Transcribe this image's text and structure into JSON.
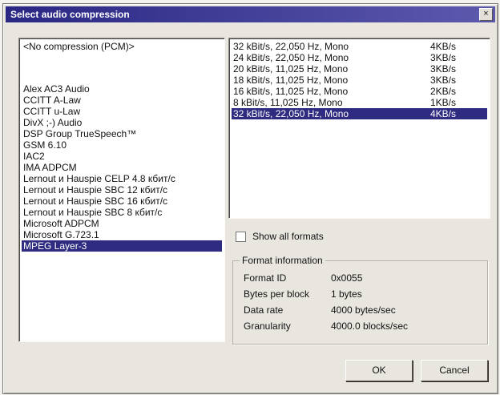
{
  "window": {
    "title": "Select audio compression",
    "close_glyph": "×"
  },
  "codecs": {
    "items": [
      "<No compression (PCM)>",
      "",
      "",
      "",
      "Alex AC3 Audio",
      "CCITT A-Law",
      "CCITT u-Law",
      "DivX ;-) Audio",
      "DSP Group TrueSpeech™",
      "GSM 6.10",
      "IAC2",
      "IMA ADPCM",
      "Lernout и Hauspie CELP 4.8 кбит/с",
      "Lernout и Hauspie SBC 12 кбит/с",
      "Lernout и Hauspie SBC 16 кбит/с",
      "Lernout и Hauspie SBC 8 кбит/с",
      "Microsoft ADPCM",
      "Microsoft G.723.1",
      "MPEG Layer-3"
    ],
    "selected": "MPEG Layer-3"
  },
  "formats": {
    "items": [
      {
        "name": "32 kBit/s, 22,050 Hz, Mono",
        "size": "4KB/s"
      },
      {
        "name": "24 kBit/s, 22,050 Hz, Mono",
        "size": "3KB/s"
      },
      {
        "name": "20 kBit/s, 11,025 Hz, Mono",
        "size": "3KB/s"
      },
      {
        "name": "18 kBit/s, 11,025 Hz, Mono",
        "size": "3KB/s"
      },
      {
        "name": "16 kBit/s, 11,025 Hz, Mono",
        "size": "2KB/s"
      },
      {
        "name": "8 kBit/s, 11,025 Hz, Mono",
        "size": "1KB/s"
      },
      {
        "name": "32 kBit/s, 22,050 Hz, Mono",
        "size": "4KB/s"
      }
    ],
    "selected_index": 6
  },
  "show_all_formats": {
    "label": "Show all formats",
    "checked": false
  },
  "format_info": {
    "legend": "Format information",
    "rows": [
      {
        "label": "Format ID",
        "value": "0x0055"
      },
      {
        "label": "Bytes per block",
        "value": "1 bytes"
      },
      {
        "label": "Data rate",
        "value": "4000 bytes/sec"
      },
      {
        "label": "Granularity",
        "value": "4000.0 blocks/sec"
      }
    ]
  },
  "buttons": {
    "ok": "OK",
    "cancel": "Cancel"
  },
  "colors": {
    "titlebar_start": "#2a2784",
    "titlebar_end": "#5c59ad",
    "selection": "#2f2b80",
    "dialog_bg": "#e9e6e0"
  }
}
